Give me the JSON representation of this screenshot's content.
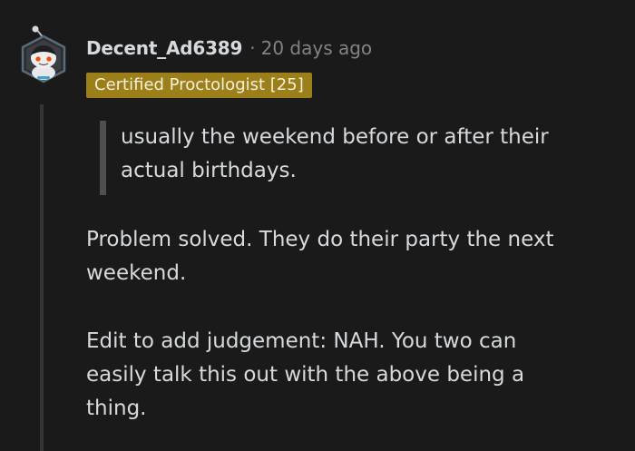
{
  "comment": {
    "username": "Decent_Ad6389",
    "separator": "·",
    "timestamp": "20 days ago",
    "flair": "Certified Proctologist [25]",
    "quote_lines": [
      "usually the weekend before or after their",
      "actual birthdays."
    ],
    "paragraphs": [
      {
        "lines": [
          "Problem solved. They do their party the next",
          "weekend."
        ]
      },
      {
        "lines": [
          "Edit to add judgement: NAH. You two can",
          "easily talk this out with the above being a",
          "thing."
        ]
      }
    ]
  },
  "colors": {
    "background": "#1a1a1b",
    "text": "#d7dadc",
    "muted": "#818384",
    "flair_bg": "#9c7f18",
    "quote_bar": "#4f4f51",
    "thread_line": "#343536"
  },
  "icons": {
    "avatar": "snoo-avatar-icon"
  }
}
